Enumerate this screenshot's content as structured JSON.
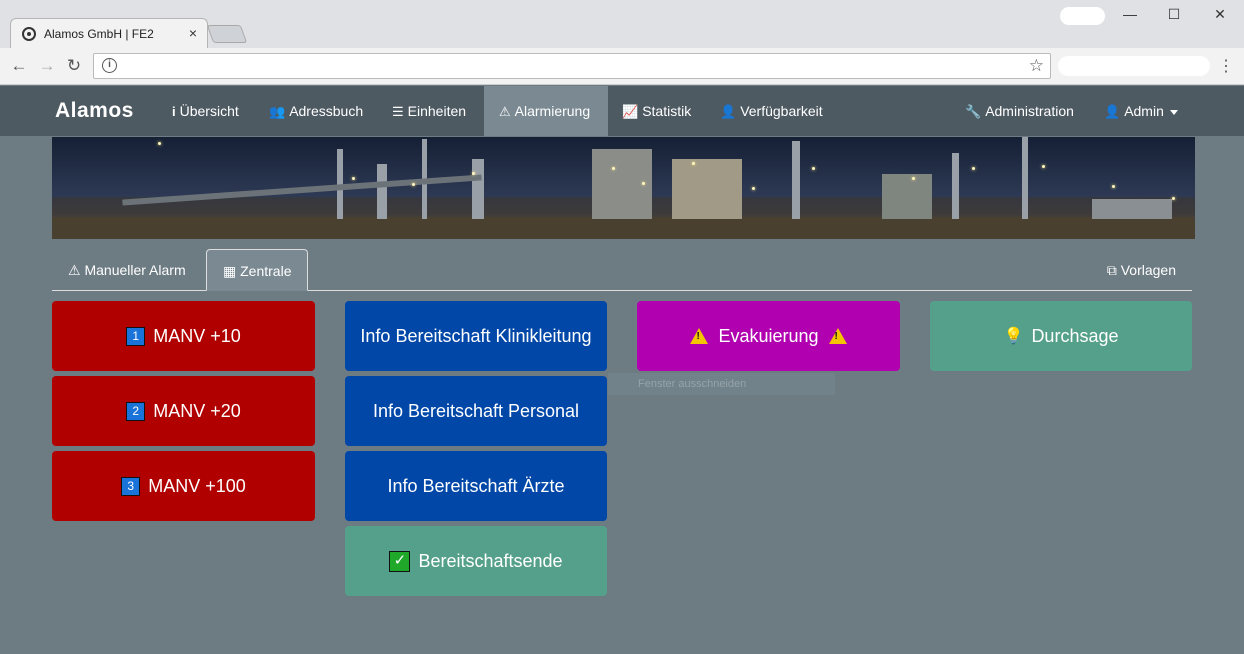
{
  "browser": {
    "tab_title": "Alamos GmbH | FE2",
    "tab_close": "×",
    "window_controls": [
      "—",
      "☐",
      "✕"
    ],
    "nav": {
      "back": "←",
      "forward": "→",
      "reload": "↻"
    },
    "star": "☆",
    "menu": "⋮",
    "info": "i"
  },
  "navbar": {
    "brand": "Alamos",
    "items": [
      {
        "label": "Übersicht",
        "icon": "info-icon",
        "glyph": "i"
      },
      {
        "label": "Adressbuch",
        "icon": "users-icon",
        "glyph": "👥"
      },
      {
        "label": "Einheiten",
        "icon": "list-icon",
        "glyph": "☰"
      },
      {
        "label": "Alarmierung",
        "icon": "warning-icon",
        "glyph": "⚠"
      },
      {
        "label": "Statistik",
        "icon": "chart-icon",
        "glyph": "📈"
      },
      {
        "label": "Verfügbarkeit",
        "icon": "user-icon",
        "glyph": "👤"
      }
    ],
    "admin_label": "Administration",
    "user_label": "Admin"
  },
  "tabs": {
    "manual": "Manueller Alarm",
    "central": "Zentrale",
    "templates": "Vorlagen"
  },
  "alarm_buttons": {
    "col1": [
      {
        "badge": "1",
        "label": "MANV +10"
      },
      {
        "badge": "2",
        "label": "MANV +20"
      },
      {
        "badge": "3",
        "label": "MANV +100"
      }
    ],
    "col2": [
      {
        "label": "Info Bereitschaft Klinikleitung"
      },
      {
        "label": "Info Bereitschaft Personal"
      },
      {
        "label": "Info Bereitschaft Ärzte"
      },
      {
        "label": "Bereitschaftsende"
      }
    ],
    "col3": [
      {
        "label": "Evakuierung"
      }
    ],
    "col4": [
      {
        "label": "Durchsage"
      }
    ]
  },
  "ghost_tooltip": "Fenster ausschneiden",
  "colors": {
    "red": "#b10000",
    "blue": "#0047a8",
    "magenta": "#b000b0",
    "green": "#55a08a",
    "navbar": "#4e5a62",
    "background": "#6d7b83"
  }
}
